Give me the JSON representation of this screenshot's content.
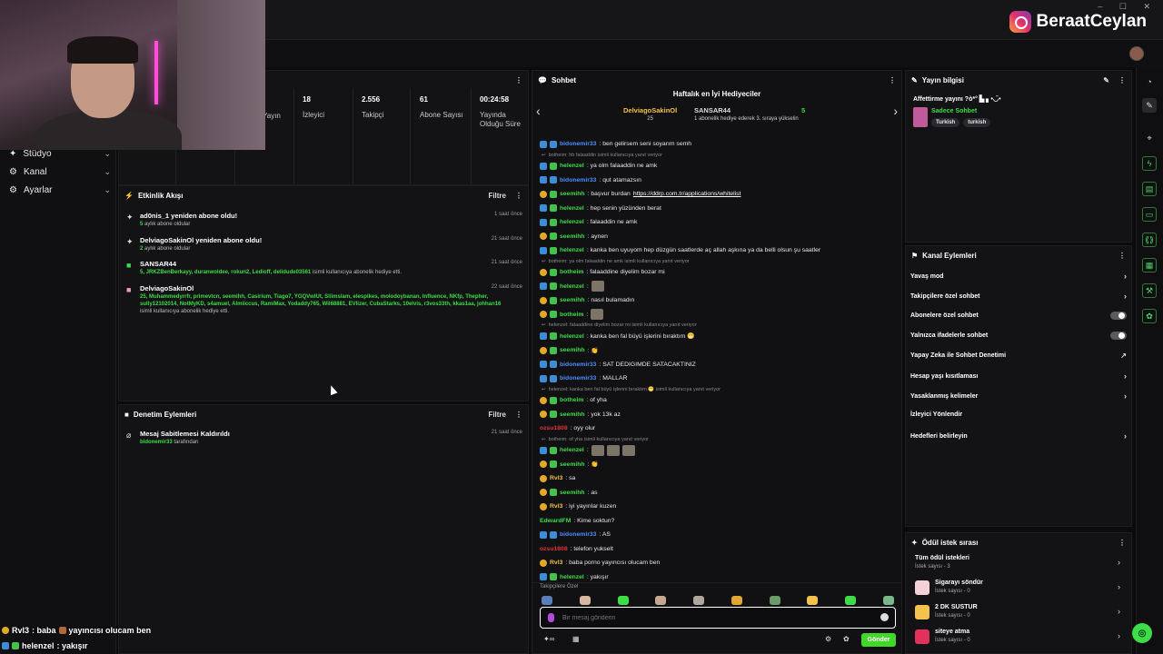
{
  "header": {
    "instagram_handle": "BeraatCeylan",
    "window_controls": "– ☐ ✕"
  },
  "leftnav": {
    "items": [
      {
        "label": "Stüdyo",
        "icon": "studio-icon"
      },
      {
        "label": "Kanal",
        "icon": "channel-icon"
      },
      {
        "label": "Ayarlar",
        "icon": "settings-icon"
      }
    ]
  },
  "stats": {
    "partial_label": "Yayın",
    "viewers": {
      "value": "18",
      "label": "İzleyici"
    },
    "followers": {
      "value": "2.556",
      "label": "Takipçi"
    },
    "subs": {
      "value": "61",
      "label": "Abone Sayısı"
    },
    "uptime": {
      "value": "00:24:58",
      "label": "Yayında Olduğu Süre"
    }
  },
  "activity": {
    "title": "Etkinlik Akışı",
    "filter": "Filtre",
    "events": [
      {
        "title": "ad0nis_1 yeniden abone oldu!",
        "sub_highlight": "5",
        "sub": " aylık abone oldular",
        "time": "1 saat önce"
      },
      {
        "title": "DelviagoSakinOl yeniden abone oldu!",
        "sub_highlight": "2",
        "sub": " aylık abone oldular",
        "time": "21 saat önce"
      },
      {
        "title": "SANSAR44",
        "sub_highlight": "5, JRKZBenBerkayy, duranwoldee, rokun2, Ledioff, delidude03561",
        "sub": " isimli kullanıcıya abonelik hediye etti.",
        "time": "21 saat önce"
      },
      {
        "title": "DelviagoSakinOl",
        "sub_highlight": "25, Muhammedyrrfr, primevtcn, seemihh, Casirium, Tiago7, YGQVwIUt, Sliimslam, elespikes, molodoybanan, Influence, NKfp, Thepher, sully12102014, NotMyKD, s4amuel, Almiiccus, RamiMax, Yodaddy765, Wil68881, EVlizer, CubaStarks, 10elvis, r3vos33th, kkas1aa, johhan16",
        "sub": " isimli kullanıcıya abonelik hediye etti.",
        "time": "22 saat önce"
      }
    ]
  },
  "moderation": {
    "title": "Denetim Eylemleri",
    "filter": "Filtre",
    "events": [
      {
        "title": "Mesaj Sabitlemesi Kaldırıldı",
        "user": "bidonemir33",
        "suffix": " tarafından",
        "time": "21 saat önce"
      }
    ]
  },
  "chat": {
    "title": "Sohbet",
    "hype_title": "Haftalık en İyi Hediyeciler",
    "gifter1": {
      "name": "DelviagoSakinOl",
      "count": "25"
    },
    "gifter2": {
      "name": "SANSAR44",
      "count": "5",
      "note": "1 abonelik hediye ederek 3. sıraya yükselin"
    },
    "messages": [
      {
        "type": "msg",
        "badges": [
          "blue",
          "blue"
        ],
        "user": "bidonemir33",
        "color": "blue",
        "text": ": ben gelirsem seni soyarım semh"
      },
      {
        "type": "reply",
        "text": "botheim: hb falaaddin isimli kullanıcıya yanıt veriyor"
      },
      {
        "type": "msg",
        "badges": [
          "blue",
          "green"
        ],
        "user": "helenzel",
        "color": "green",
        "text": ": ya olm falaaddin ne amk"
      },
      {
        "type": "msg",
        "badges": [
          "blue",
          "blue"
        ],
        "user": "bidonemir33",
        "color": "blue",
        "text": ": qut atamazsın"
      },
      {
        "type": "msg",
        "badges": [
          "gold",
          "green"
        ],
        "user": "seemihh",
        "color": "green",
        "text": ": başvur burdan ",
        "link": "https://ddrp.com.tr/applications/whitelist"
      },
      {
        "type": "msg",
        "badges": [
          "blue",
          "green"
        ],
        "user": "helenzel",
        "color": "green",
        "text": ": hep senin yüzünden berat"
      },
      {
        "type": "msg",
        "badges": [
          "blue",
          "green"
        ],
        "user": "helenzel",
        "color": "green",
        "text": ": falaaddin ne amk"
      },
      {
        "type": "msg",
        "badges": [
          "gold",
          "green"
        ],
        "user": "seemihh",
        "color": "green",
        "text": ": aynen"
      },
      {
        "type": "msg",
        "badges": [
          "blue",
          "green"
        ],
        "user": "helenzel",
        "color": "green",
        "text": ": kanka ben uyuyom hep düzgün saatlerde aç allah aşkına ya da belli olsun şu saatler"
      },
      {
        "type": "reply",
        "text": "botheim: ya olm falaaddin ne amk isimli kullanıcıya yanıt veriyor"
      },
      {
        "type": "msg",
        "badges": [
          "gold",
          "green"
        ],
        "user": "botheim",
        "color": "green",
        "text": ": falaaddine diyelim bozar mi"
      },
      {
        "type": "msg",
        "badges": [
          "blue",
          "green"
        ],
        "user": "helenzel",
        "color": "green",
        "text": ":",
        "emote": 1
      },
      {
        "type": "msg",
        "badges": [
          "gold",
          "green"
        ],
        "user": "seemihh",
        "color": "green",
        "text": ": nasıl bulamadın"
      },
      {
        "type": "msg",
        "badges": [
          "gold",
          "green"
        ],
        "user": "botheim",
        "color": "green",
        "text": ":",
        "emote": 1
      },
      {
        "type": "reply",
        "text": "helenzel: falaaddine diyelim bozar mi isimli kullanıcıya yanıt veriyor"
      },
      {
        "type": "msg",
        "badges": [
          "blue",
          "green"
        ],
        "user": "helenzel",
        "color": "green",
        "text": ": kanka ben fal büyü işlerini bıraktım 😁"
      },
      {
        "type": "msg",
        "badges": [
          "gold",
          "green"
        ],
        "user": "seemihh",
        "color": "green",
        "text": ": 👏"
      },
      {
        "type": "msg",
        "badges": [
          "blue",
          "blue"
        ],
        "user": "bidonemir33",
        "color": "blue",
        "text": ": SAT DEDIGIMDE SATACAKTINIZ"
      },
      {
        "type": "msg",
        "badges": [
          "blue",
          "blue"
        ],
        "user": "bidonemir33",
        "color": "blue",
        "text": ": MALLAR"
      },
      {
        "type": "reply",
        "text": "helenzel: kanka ben fal büyü işlerini bıraktım 😁 isimli kullanıcıya yanıt veriyor"
      },
      {
        "type": "msg",
        "badges": [
          "gold",
          "green"
        ],
        "user": "botheim",
        "color": "green",
        "text": ": of yha"
      },
      {
        "type": "msg",
        "badges": [
          "gold",
          "green"
        ],
        "user": "seemihh",
        "color": "green",
        "text": ": yok 13k az"
      },
      {
        "type": "msg",
        "badges": [],
        "user": "ozsu1808",
        "color": "red",
        "text": ": oyy olur"
      },
      {
        "type": "reply",
        "text": "botheim: of yha isimli kullanıcıya yanıt veriyor"
      },
      {
        "type": "msg",
        "badges": [
          "blue",
          "green"
        ],
        "user": "helenzel",
        "color": "green",
        "text": ":",
        "emote": 3
      },
      {
        "type": "msg",
        "badges": [
          "gold",
          "green"
        ],
        "user": "seemihh",
        "color": "green",
        "text": ": 👏"
      },
      {
        "type": "msg",
        "badges": [
          "gold"
        ],
        "user": "Rvl3",
        "color": "gold",
        "text": ": sa"
      },
      {
        "type": "msg",
        "badges": [
          "gold",
          "green"
        ],
        "user": "seemihh",
        "color": "green",
        "text": ": as"
      },
      {
        "type": "msg",
        "badges": [
          "gold"
        ],
        "user": "Rvl3",
        "color": "gold",
        "text": ": iyi yayınlar kuzen"
      },
      {
        "type": "msg",
        "badges": [],
        "user": "EdwardFM",
        "color": "green",
        "text": ": Kime soktun?"
      },
      {
        "type": "msg",
        "badges": [
          "blue",
          "blue"
        ],
        "user": "bidonemir33",
        "color": "blue",
        "text": ": AS"
      },
      {
        "type": "msg",
        "badges": [],
        "user": "ozsu1808",
        "color": "red",
        "text": ": telefon yukselt"
      },
      {
        "type": "msg",
        "badges": [
          "gold"
        ],
        "user": "Rvl3",
        "color": "gold",
        "text": ": baba porno yayıncısı olucam ben"
      },
      {
        "type": "msg",
        "badges": [
          "blue",
          "green"
        ],
        "user": "helenzel",
        "color": "green",
        "text": ": yakışır"
      }
    ],
    "followers_only_note": "Takipçilere Özel",
    "input_placeholder": "Bir mesaj gönderin",
    "send_label": "Gönder"
  },
  "stream_info": {
    "title": "Yayın bilgisi",
    "stream_title": "Affettirme yayını ?ò*° ▙ ▖•◡̈•",
    "category": "Sadece Sohbet",
    "tags": [
      "Turkish",
      "turkish"
    ]
  },
  "channel_actions": {
    "title": "Kanal Eylemleri",
    "items": [
      {
        "label": "Yavaş mod",
        "kind": "arrow"
      },
      {
        "label": "Takipçilere özel sohbet",
        "kind": "arrow"
      },
      {
        "label": "Abonelere özel sohbet",
        "kind": "toggle"
      },
      {
        "label": "Yalnızca ifadelerle sohbet",
        "kind": "toggle"
      },
      {
        "label": "Yapay Zeka ile Sohbet Denetimi",
        "kind": "external"
      },
      {
        "label": "Hesap yaşı kısıtlaması",
        "kind": "arrow"
      },
      {
        "label": "Yasaklanmış kelimeler",
        "kind": "arrow"
      },
      {
        "label": "İzleyici Yönlendir",
        "kind": "none"
      },
      {
        "label": "Hedefleri belirleyin",
        "kind": "arrow"
      }
    ]
  },
  "rewards": {
    "title": "Ödül istek sırası",
    "items": [
      {
        "name": "Tüm ödül istekleri",
        "count": "İstek sayısı - 3",
        "color": ""
      },
      {
        "name": "Sigarayı söndür",
        "count": "İstek sayısı - 0",
        "color": "#f5d0d6"
      },
      {
        "name": "2 DK SUSTUR",
        "count": "İstek sayısı - 0",
        "color": "#f2c14e"
      },
      {
        "name": "siteye atma",
        "count": "İstek sayısı - 0",
        "color": "#e0325a"
      }
    ]
  },
  "stream_overlay": [
    {
      "user": "Rvl3",
      "text": " : baba ",
      "tail": " yayıncısı olucam ben"
    },
    {
      "user": "helenzel",
      "text": " : yakışır",
      "tail": ""
    }
  ]
}
